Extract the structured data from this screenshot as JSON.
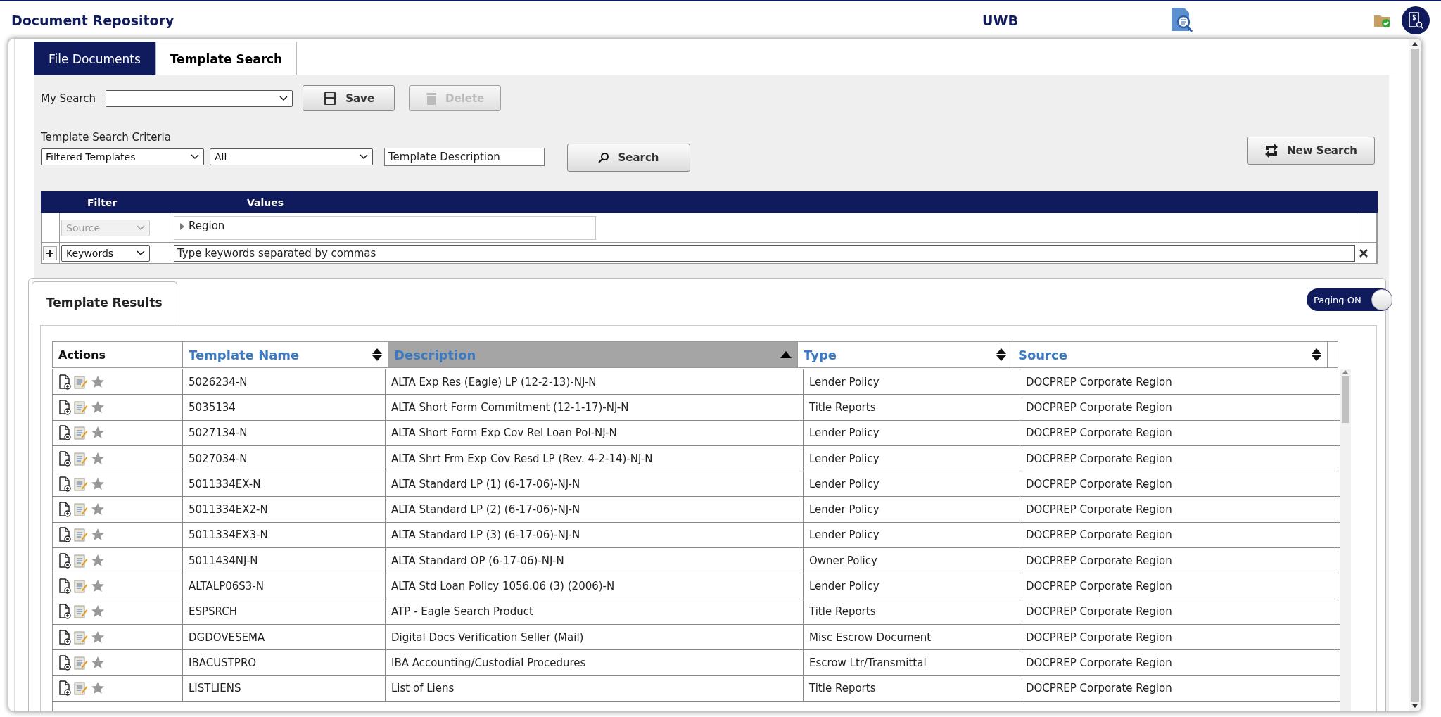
{
  "header": {
    "title": "Document Repository",
    "center_label": "UWB"
  },
  "tabs": [
    {
      "label": "File Documents",
      "selected": false
    },
    {
      "label": "Template Search",
      "selected": true
    }
  ],
  "my_search": {
    "label": "My Search",
    "buttons": [
      {
        "kind": "save",
        "label": "Save",
        "disabled": false
      },
      {
        "kind": "delete",
        "label": "Delete",
        "disabled": true
      }
    ]
  },
  "criteria": {
    "label": "Template Search Criteria",
    "selects": [
      "Filtered Templates",
      "All"
    ],
    "description_value": "Template Description",
    "search_button": {
      "label": "Search"
    },
    "new_search_button": {
      "label": "New Search"
    }
  },
  "filter_table": {
    "columns": [
      "Filter",
      "Values"
    ],
    "rows": [
      {
        "kind": "tree",
        "filter": "Source",
        "disabled": true,
        "value": "Region"
      },
      {
        "kind": "keywords",
        "filter": "Keywords",
        "disabled": false,
        "value": "Type keywords separated by commas"
      }
    ]
  },
  "results": {
    "tab": "Template Results",
    "paging": {
      "label": "Paging ON",
      "on": true
    },
    "columns": [
      {
        "label": "Actions",
        "sortable": false,
        "sorted": false
      },
      {
        "label": "Template Name",
        "sortable": true,
        "sorted": false
      },
      {
        "label": "Description",
        "sortable": true,
        "sorted": true
      },
      {
        "label": "Type",
        "sortable": true,
        "sorted": false
      },
      {
        "label": "Source",
        "sortable": true,
        "sorted": false
      }
    ],
    "rows": [
      {
        "name": "5026234-N",
        "description": "ALTA Exp Res (Eagle) LP (12-2-13)-NJ-N",
        "type": "Lender Policy",
        "source": "DOCPREP Corporate Region"
      },
      {
        "name": "5035134",
        "description": "ALTA Short Form Commitment (12-1-17)-NJ-N",
        "type": "Title Reports",
        "source": "DOCPREP Corporate Region"
      },
      {
        "name": "5027134-N",
        "description": "ALTA Short Form Exp Cov Rel Loan Pol-NJ-N",
        "type": "Lender Policy",
        "source": "DOCPREP Corporate Region"
      },
      {
        "name": "5027034-N",
        "description": "ALTA Shrt Frm Exp Cov Resd LP (Rev. 4-2-14)-NJ-N",
        "type": "Lender Policy",
        "source": "DOCPREP Corporate Region"
      },
      {
        "name": "5011334EX-N",
        "description": "ALTA Standard LP (1) (6-17-06)-NJ-N",
        "type": "Lender Policy",
        "source": "DOCPREP Corporate Region"
      },
      {
        "name": "5011334EX2-N",
        "description": "ALTA Standard LP (2) (6-17-06)-NJ-N",
        "type": "Lender Policy",
        "source": "DOCPREP Corporate Region"
      },
      {
        "name": "5011334EX3-N",
        "description": "ALTA Standard LP (3) (6-17-06)-NJ-N",
        "type": "Lender Policy",
        "source": "DOCPREP Corporate Region"
      },
      {
        "name": "5011434NJ-N",
        "description": "ALTA Standard OP (6-17-06)-NJ-N",
        "type": "Owner Policy",
        "source": "DOCPREP Corporate Region"
      },
      {
        "name": "ALTALP06S3-N",
        "description": "ALTA Std Loan Policy 1056.06 (3) (2006)-N",
        "type": "Lender Policy",
        "source": "DOCPREP Corporate Region"
      },
      {
        "name": "ESPSRCH",
        "description": "ATP - Eagle Search Product",
        "type": "Title Reports",
        "source": "DOCPREP Corporate Region"
      },
      {
        "name": "DGDOVESEMA",
        "description": "Digital Docs Verification Seller (Mail)",
        "type": "Misc Escrow Document",
        "source": "DOCPREP Corporate Region"
      },
      {
        "name": "IBACUSTPRO",
        "description": "IBA Accounting/Custodial Procedures",
        "type": "Escrow Ltr/Transmittal",
        "source": "DOCPREP Corporate Region"
      },
      {
        "name": "LISTLIENS",
        "description": "List of Liens",
        "type": "Title Reports",
        "source": "DOCPREP Corporate Region"
      }
    ]
  }
}
